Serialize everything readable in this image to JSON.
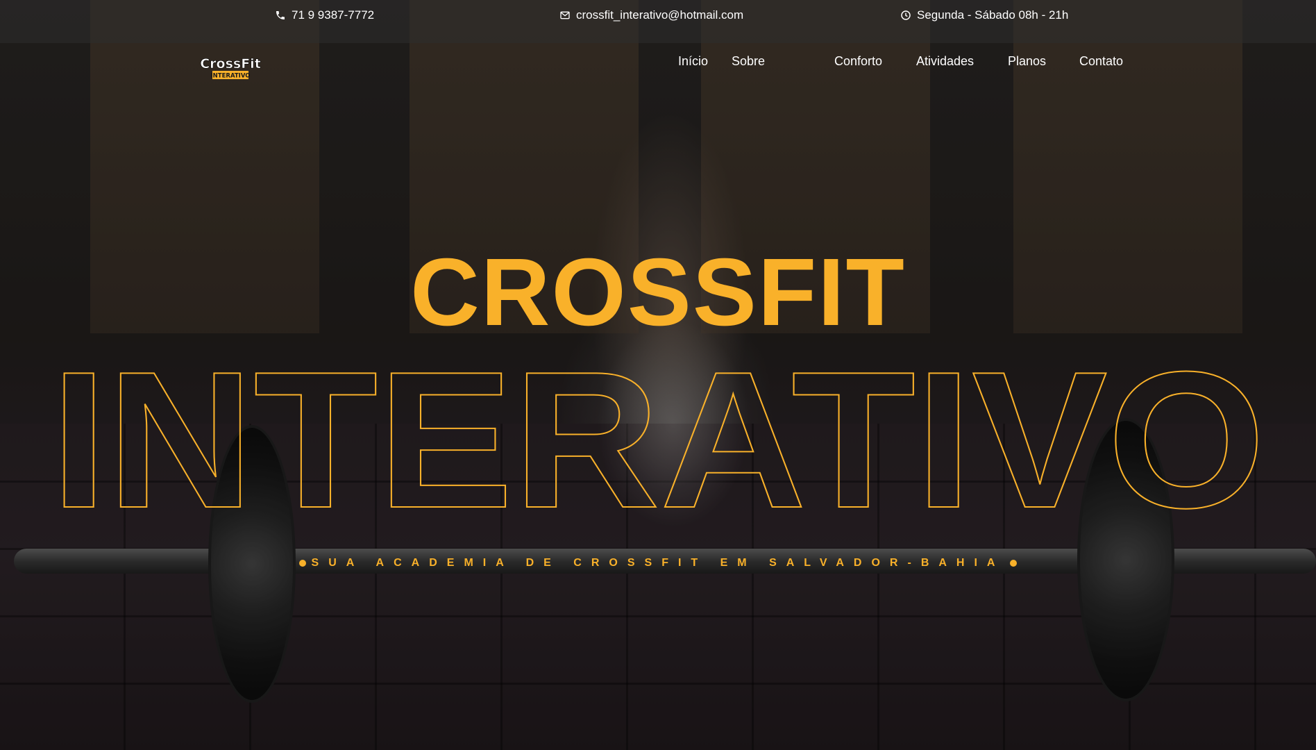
{
  "topbar": {
    "phone": "71 9 9387-7772",
    "email": "crossfit_interativo@hotmail.com",
    "hours": "Segunda - Sábado 08h - 21h",
    "phone_icon": "phone-icon",
    "email_icon": "mail-icon",
    "hours_icon": "clock-icon"
  },
  "logo": {
    "line1": "CrossFit",
    "line2": "INTERATIVO"
  },
  "nav": {
    "items": [
      "Início",
      "Sobre",
      "Conforto",
      "Atividades",
      "Planos",
      "Contato"
    ]
  },
  "hero": {
    "title": "CROSSFIT",
    "subtitle_outline": "INTERATIVO",
    "tagline": "SUA ACADEMIA DE CROSSFIT EM SALVADOR-BAHIA"
  },
  "colors": {
    "accent": "#f9b12a",
    "text": "#ffffff",
    "topbar_bg": "rgba(45,45,45,0.55)"
  }
}
